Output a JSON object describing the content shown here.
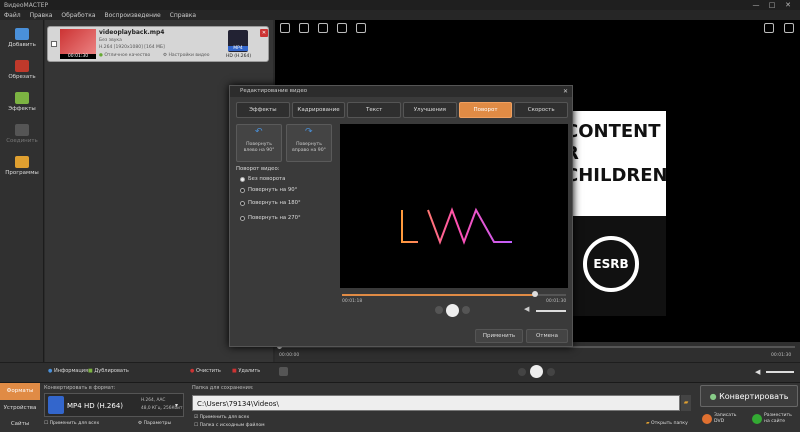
{
  "window": {
    "title": "ВидеоМАСТЕР",
    "min": "—",
    "max": "□",
    "close": "✕"
  },
  "menu": [
    "Файл",
    "Правка",
    "Обработка",
    "Воспроизведение",
    "Справка"
  ],
  "sidebar": [
    {
      "label": "Добавить",
      "color": "#4a90d9"
    },
    {
      "label": "Обрезать",
      "color": "#c0392b"
    },
    {
      "label": "Эффекты",
      "color": "#7cb342"
    },
    {
      "label": "Соединить",
      "color": "#777"
    },
    {
      "label": "Программы",
      "color": "#e0a030"
    }
  ],
  "file": {
    "name": "videoplayback.mp4",
    "audio": "Без звука",
    "codec": "H.264 [1920x1080] [164 МБ]",
    "duration": "00:01:30",
    "quality": "Отличное качество",
    "settings": "Настройки видео",
    "format_badge": "MP4",
    "format_label": "HD (H.264)"
  },
  "filebar": {
    "info": "Информация",
    "duplicate": "Дублировать",
    "clear": "Очистить",
    "delete": "Удалить"
  },
  "preview": {
    "text_line1": "CONTENT",
    "text_line2": "R CHILDREN",
    "logo": "ESRB",
    "time_start": "00:00:00",
    "time_end": "00:01:30"
  },
  "dialog": {
    "title": "Редактирование видео",
    "tabs": [
      "Эффекты",
      "Кадрирование",
      "Текст",
      "Улучшения",
      "Поворот",
      "Скорость"
    ],
    "active_tab": 4,
    "rot_left": [
      "Повернуть",
      "влево на 90°"
    ],
    "rot_right": [
      "Повернуть",
      "вправо на 90°"
    ],
    "rotate_heading": "Поворот видео:",
    "options": [
      "Без поворота",
      "Повернуть на 90°",
      "Повернуть на 180°",
      "Повернуть на 270°"
    ],
    "selected_option": 0,
    "time_current": "00:01:18",
    "time_total": "00:01:30",
    "progress": 0.86,
    "apply": "Применить",
    "cancel": "Отмена"
  },
  "bottom": {
    "formats_tab": "Форматы",
    "devices_tab": "Устройства",
    "sites_tab": "Сайты",
    "convert_label": "Конвертировать в формат:",
    "format_name": "MP4 HD (H.264)",
    "format_spec1": "H.264, AAC",
    "format_spec2": "48,0 КГц, 256Кбит",
    "apply_all": "Применить для всех",
    "params": "Параметры",
    "save_label": "Папка для сохранения:",
    "save_path": "C:\\Users\\79134\\Videos\\",
    "apply_all2": "Применить для всех",
    "source_folder": "Папка с исходным файлом",
    "open_folder": "Открыть папку",
    "convert_btn": "Конвертировать",
    "dvd": "Записать DVD",
    "web": "Разместить на сайте"
  }
}
